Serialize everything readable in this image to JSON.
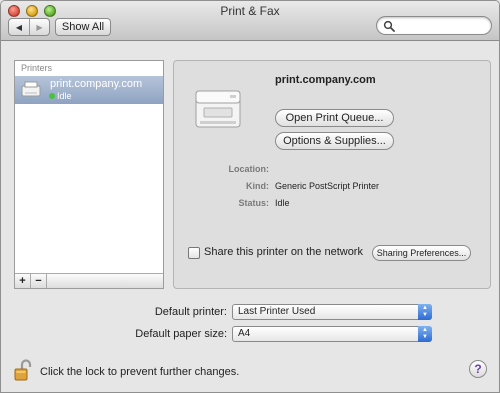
{
  "window": {
    "title": "Print & Fax"
  },
  "toolbar": {
    "back_glyph": "◀",
    "forward_glyph": "▶",
    "show_all_label": "Show All",
    "search_value": ""
  },
  "printers": {
    "header": "Printers",
    "items": [
      {
        "name": "print.company.com",
        "status": "Idle",
        "status_color": "#49c23a"
      }
    ],
    "add_label": "+",
    "remove_label": "−"
  },
  "detail": {
    "name": "print.company.com",
    "open_queue_label": "Open Print Queue...",
    "options_label": "Options & Supplies...",
    "location_label": "Location:",
    "location_value": "",
    "kind_label": "Kind:",
    "kind_value": "Generic PostScript Printer",
    "status_label": "Status:",
    "status_value": "Idle",
    "share_label": "Share this printer on the network",
    "share_checked": false,
    "sharing_prefs_label": "Sharing Preferences..."
  },
  "defaults": {
    "printer_label": "Default printer:",
    "printer_value": "Last Printer Used",
    "paper_label": "Default paper size:",
    "paper_value": "A4"
  },
  "footer": {
    "lock_text": "Click the lock to prevent further changes.",
    "help_label": "?"
  },
  "colors": {
    "selection": "#8ea3c2",
    "select_arrow": "#2d6bd2"
  }
}
